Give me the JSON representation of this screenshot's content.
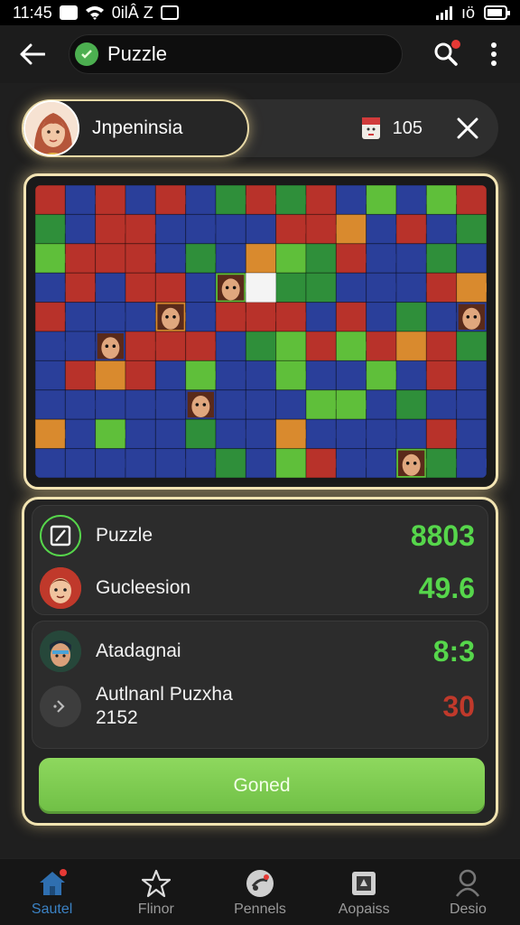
{
  "status_bar": {
    "time": "11:45",
    "carrier": "0ilÂ Z",
    "network": "ıö"
  },
  "app_bar": {
    "title": "Puzzle"
  },
  "player": {
    "name": "Jnpeninsia",
    "score": "105"
  },
  "colors": {
    "accent_green": "#56d64b",
    "red_value": "#c0392b",
    "glow": "#f3e4b4",
    "nav_active": "#3b82c4"
  },
  "stats": [
    {
      "label": "Puzzle",
      "sub": "",
      "value": "8803",
      "color": "green",
      "icon": "pencil-square-icon"
    },
    {
      "label": "Gucleesion",
      "sub": "",
      "value": "49.6",
      "color": "green",
      "icon": "avatar-icon"
    },
    {
      "label": "Atadagnai",
      "sub": "",
      "value": "8:3",
      "color": "green",
      "icon": "avatar-icon"
    },
    {
      "label": "Autlnanl Puzxha",
      "sub": "2152",
      "value": "30",
      "color": "red",
      "icon": "arrow-icon"
    }
  ],
  "cta": {
    "label": "Goned"
  },
  "nav": [
    {
      "label": "Sautel",
      "icon": "home-icon",
      "active": true
    },
    {
      "label": "Flinor",
      "icon": "star-icon",
      "active": false
    },
    {
      "label": "Pennels",
      "icon": "puzzle-icon",
      "active": false
    },
    {
      "label": "Aopaiss",
      "icon": "box-icon",
      "active": false
    },
    {
      "label": "Desio",
      "icon": "person-icon",
      "active": false
    }
  ]
}
